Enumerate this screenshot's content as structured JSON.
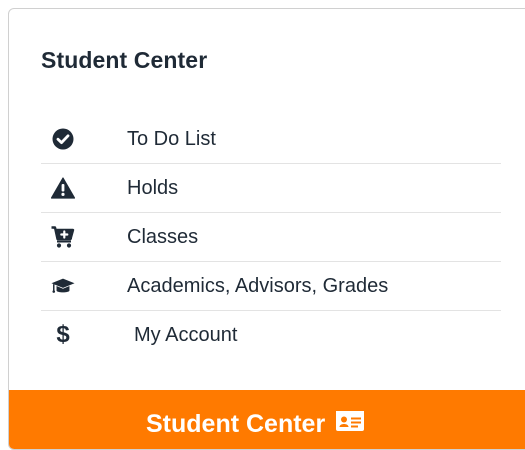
{
  "card": {
    "title": "Student Center"
  },
  "menu": {
    "items": [
      {
        "label": "To Do List",
        "icon": "check-circle-icon"
      },
      {
        "label": "Holds",
        "icon": "warning-triangle-icon"
      },
      {
        "label": "Classes",
        "icon": "cart-plus-icon"
      },
      {
        "label": "Academics, Advisors, Grades",
        "icon": "graduation-cap-icon"
      },
      {
        "label": "My Account",
        "icon": "dollar-icon",
        "glyph": "$"
      }
    ]
  },
  "button": {
    "label": "Student Center",
    "icon": "id-card-icon",
    "color": "#ff7a00"
  },
  "colors": {
    "text": "#1f2a36",
    "divider": "#e3e3e3",
    "border": "#d0d0d0"
  }
}
